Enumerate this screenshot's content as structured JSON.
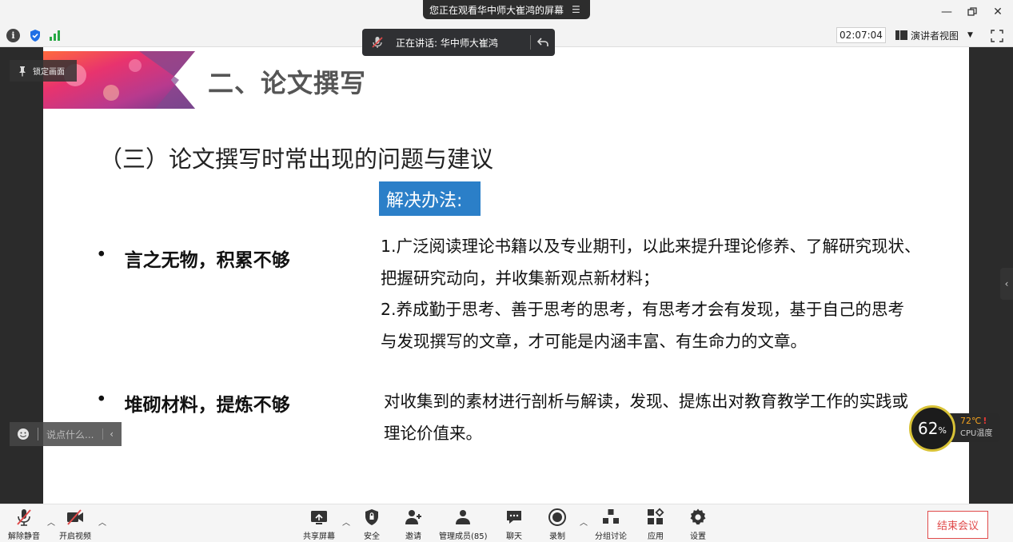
{
  "window": {
    "share_banner": "您正在观看华中师大崔鸿的屏幕",
    "menu_icon": "hamburger-icon",
    "controls": [
      "minimize-icon",
      "restore-icon",
      "close-icon"
    ]
  },
  "infobar": {
    "timer": "02:07:04",
    "view_mode": "演讲者视图",
    "speaker_prefix": "正在讲话: 华中师大崔鸿",
    "signal_color": "#27a844",
    "shield_color": "#1f6fe5"
  },
  "overlay": {
    "pin_label": "锁定画面",
    "chat_placeholder": "说点什么...",
    "cpu_percent": "62",
    "cpu_percent_unit": "%",
    "cpu_temp": "72℃",
    "cpu_temp_alert": "!",
    "cpu_label": "CPU温度"
  },
  "slide": {
    "heading": "二、论文撰写",
    "subheading": "（三）论文撰写时常出现的问题与建议",
    "solution_tag": "解决办法:",
    "tag_color": "#2b7fc8",
    "problems": [
      {
        "bullet": "•",
        "title": "言之无物，积累不够",
        "lines": [
          "1.广泛阅读理论书籍以及专业期刊，以此来提升理论修养、了解研究现状、",
          "把握研究动向，并收集新观点新材料；",
          "2.养成勤于思考、善于思考的思考，有思考才会有发现，基于自己的思考",
          "与发现撰写的文章，才可能是内涵丰富、有生命力的文章。"
        ]
      },
      {
        "bullet": "•",
        "title": "堆砌材料，提炼不够",
        "lines": [
          "对收集到的素材进行剖析与解读，发现、提炼出对教育教学工作的实践或",
          "理论价值来。"
        ]
      }
    ]
  },
  "toolbar": {
    "unmute": "解除静音",
    "start_video": "开启视频",
    "share_screen": "共享屏幕",
    "security": "安全",
    "invite": "邀请",
    "manage_members": "管理成员(85)",
    "chat": "聊天",
    "record": "录制",
    "breakout": "分组讨论",
    "apps": "应用",
    "settings": "设置",
    "end_meeting": "结束会议",
    "end_color": "#e04a4a",
    "muted_color": "#e04a4a"
  }
}
